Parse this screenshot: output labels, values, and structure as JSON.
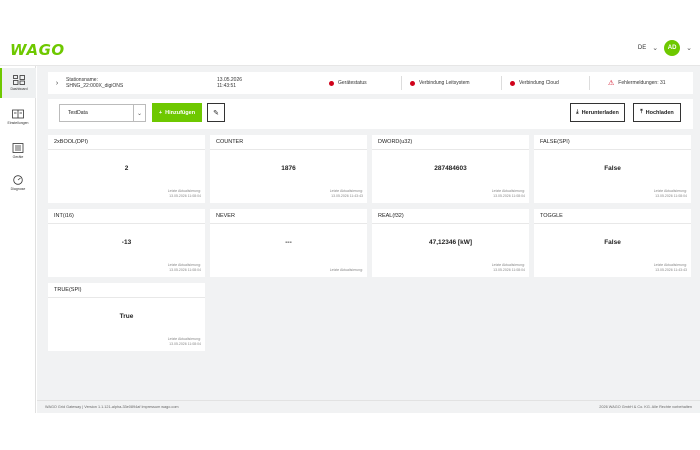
{
  "header": {
    "logo": "WAGO",
    "language": "DE",
    "avatar_initials": "AD",
    "accent_color": "#6ec800"
  },
  "sidebar": {
    "items": [
      {
        "label": "Dashboard",
        "icon": "dashboard-icon",
        "active": true
      },
      {
        "label": "Einstellungen",
        "icon": "settings-icon",
        "active": false
      },
      {
        "label": "Geräte",
        "icon": "device-icon",
        "active": false
      },
      {
        "label": "Diagnose",
        "icon": "diagnose-icon",
        "active": false
      }
    ]
  },
  "infobar": {
    "station_label": "Stationsname:",
    "station_name": "SHNG_22:000X_digiONS",
    "date": "13.05.2026",
    "time": "11:43:51",
    "status_device": "Gerätestatus",
    "status_control": "Verbindung Leitsystem",
    "status_cloud": "Verbindung Cloud",
    "errors": "Fehlermeldungen: 31",
    "status_color": "#d0021b"
  },
  "toolbar": {
    "select_value": "TestData",
    "add_label": "Hinzufügen",
    "download_label": "Herunterladen",
    "upload_label": "Hochladen"
  },
  "cards": [
    {
      "title": "2xBOOL(DPI)",
      "value": "2",
      "updated_label": "Letzte Aktualisierung:",
      "updated": "13.05.2026 11:08:04"
    },
    {
      "title": "COUNTER",
      "value": "1876",
      "updated_label": "Letzte Aktualisierung:",
      "updated": "13.05.2026 11:43:43"
    },
    {
      "title": "DWORD(u32)",
      "value": "287484603",
      "updated_label": "Letzte Aktualisierung:",
      "updated": "13.05.2026 11:08:04"
    },
    {
      "title": "FALSE(SPI)",
      "value": "False",
      "updated_label": "Letzte Aktualisierung:",
      "updated": "13.05.2026 11:08:04"
    },
    {
      "title": "INT(i16)",
      "value": "-13",
      "updated_label": "Letzte Aktualisierung:",
      "updated": "13.05.2026 11:08:04"
    },
    {
      "title": "NEVER",
      "value": "---",
      "updated_label": "Letzte Aktualisierung:",
      "updated": ""
    },
    {
      "title": "REAL(f32)",
      "value": "47,12346 [kW]",
      "updated_label": "Letzte Aktualisierung:",
      "updated": "13.05.2026 11:08:04"
    },
    {
      "title": "TOGGLE",
      "value": "False",
      "updated_label": "Letzte Aktualisierung:",
      "updated": "13.05.2026 11:43:43"
    },
    {
      "title": "TRUE(SPI)",
      "value": "True",
      "updated_label": "Letzte Aktualisierung:",
      "updated": "13.05.2026 11:08:04"
    }
  ],
  "footer": {
    "left": "WAGO Grid Gateway | Version 1.1.121-alpha-33e0894af   Impressum   wago.com",
    "right": "2026 WAGO GmbH & Co. KG. Alle Rechte vorbehalten"
  }
}
